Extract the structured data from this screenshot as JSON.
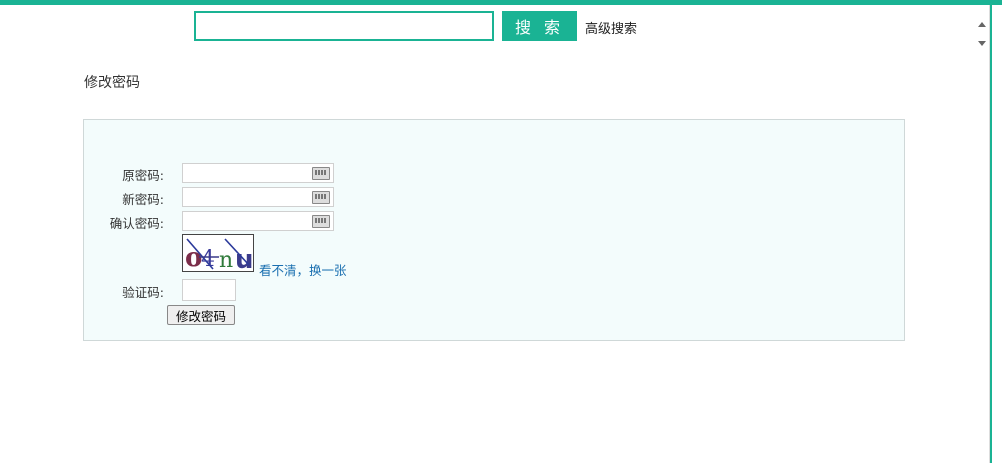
{
  "search": {
    "placeholder": "",
    "value": "",
    "button_label": "搜 索",
    "advanced_label": "高级搜索"
  },
  "page": {
    "title": "修改密码"
  },
  "form": {
    "old_password_label": "原密码:",
    "new_password_label": "新密码:",
    "confirm_password_label": "确认密码:",
    "captcha_text": "o4nu",
    "captcha_refresh_label": "看不清，换一张",
    "code_label": "验证码:",
    "submit_label": "修改密码"
  },
  "colors": {
    "accent": "#1ab394",
    "panel_bg": "#f3fcfc",
    "link": "#1a6fb0"
  }
}
